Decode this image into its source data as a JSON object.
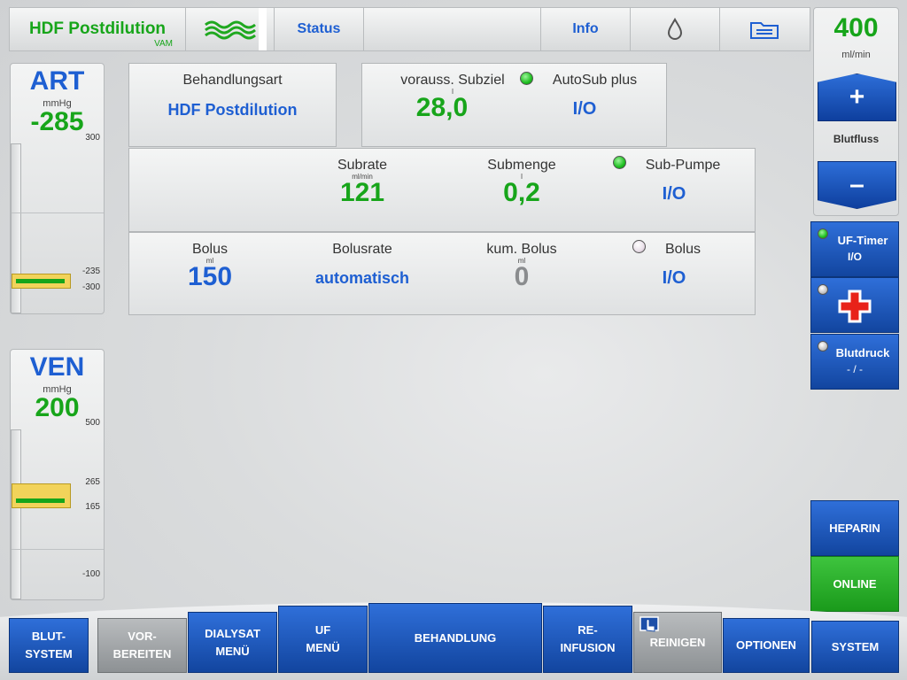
{
  "topbar": {
    "title": "HDF Postdilution",
    "title_sub": "VAM",
    "flow_icon": "wave-icon",
    "status": "Status",
    "info": "Info",
    "drop_icon": "drop-icon",
    "folder_icon": "folder-icon"
  },
  "bloodflow": {
    "value": "400",
    "unit": "ml/min",
    "plus": "+",
    "label": "Blutfluss",
    "minus": "–"
  },
  "side_buttons": {
    "uf_timer": {
      "label": "UF-Timer",
      "value": "I/O",
      "led": "green"
    },
    "firstaid": {
      "icon": "first-aid-cross-icon",
      "led": "gray"
    },
    "blutdruck": {
      "label": "Blutdruck",
      "value": "- / -",
      "led": "gray"
    },
    "heparin": "HEPARIN",
    "online": "ONLINE"
  },
  "art": {
    "name": "ART",
    "unit": "mmHg",
    "value": "-285",
    "ticks": [
      "300",
      "-235",
      "-300"
    ]
  },
  "ven": {
    "name": "VEN",
    "unit": "mmHg",
    "value": "200",
    "ticks": [
      "500",
      "265",
      "165",
      "-100"
    ]
  },
  "behandlung": {
    "label": "Behandlungsart",
    "value": "HDF Postdilution"
  },
  "subziel": {
    "label": "vorauss. Subziel",
    "unit": "l",
    "value": "28,0",
    "autosub_label": "AutoSub plus",
    "autosub_value": "I/O"
  },
  "sub": {
    "rate_label": "Subrate",
    "rate_unit": "ml/min",
    "rate_value": "121",
    "menge_label": "Submenge",
    "menge_unit": "l",
    "menge_value": "0,2",
    "pumpe_label": "Sub-Pumpe",
    "pumpe_value": "I/O"
  },
  "bolus": {
    "label": "Bolus",
    "unit": "ml",
    "value": "150",
    "rate_label": "Bolusrate",
    "rate_value": "automatisch",
    "kum_label": "kum. Bolus",
    "kum_unit": "ml",
    "kum_value": "0",
    "switch_label": "Bolus",
    "switch_value": "I/O"
  },
  "nav": [
    {
      "l1": "BLUT-",
      "l2": "SYSTEM"
    },
    {
      "l1": "VOR-",
      "l2": "BEREITEN"
    },
    {
      "l1": "DIALYSAT",
      "l2": "MENÜ"
    },
    {
      "l1": "UF",
      "l2": "MENÜ"
    },
    {
      "l1": "BEHANDLUNG",
      "l2": ""
    },
    {
      "l1": "RE-",
      "l2": "INFUSION"
    },
    {
      "l1": "REINIGEN",
      "l2": ""
    },
    {
      "l1": "OPTIONEN",
      "l2": ""
    },
    {
      "l1": "SYSTEM",
      "l2": ""
    }
  ],
  "colors": {
    "accent_blue": "#1e5fd2",
    "value_green": "#17a51a",
    "button_blue": "#12459f",
    "online_green": "#1ea21f"
  }
}
